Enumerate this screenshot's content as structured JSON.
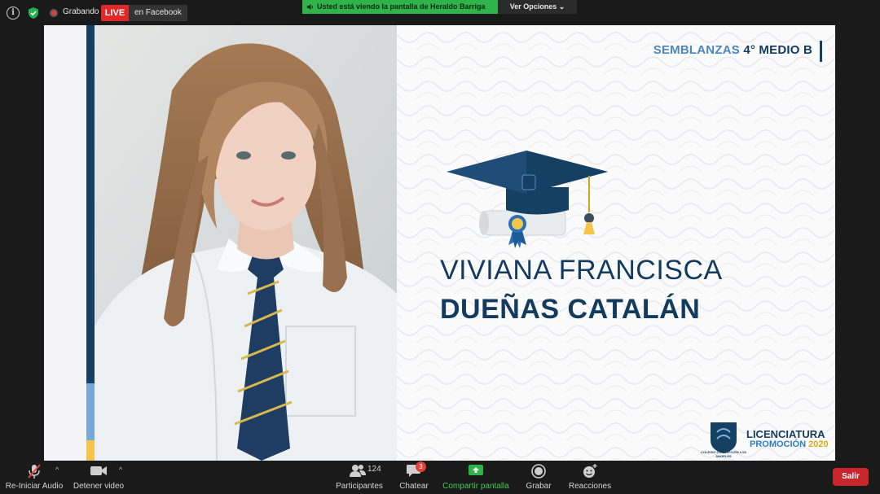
{
  "top_bar": {
    "recording_label": "Grabando",
    "live_badge": "LIVE",
    "live_destination": "en Facebook",
    "share_banner": "Usted está viendo la pantalla de Heraldo Barriga",
    "view_options": "Ver Opciones ⌄"
  },
  "slide": {
    "header_prefix": "SEMBLANZAS",
    "header_class": "4° MEDIO B",
    "name_line1": "VIVIANA FRANCISCA",
    "name_line2": "DUEÑAS CATALÁN",
    "footer_logo_text": "COLEGIO CONCEPCIÓN LOS ÁNGELES",
    "footer_title": "LICENCIATURA",
    "footer_sub_prefix": "PROMOCIÓN",
    "footer_sub_year": "2020",
    "colors": {
      "navy": "#123b5e",
      "light_blue": "#4d86b8",
      "gold": "#f3c64a"
    }
  },
  "toolbar": {
    "audio_label": "Re-Iniciar Audio",
    "video_label": "Detener video",
    "participants_label": "Participantes",
    "participants_count": "124",
    "chat_label": "Chatear",
    "chat_badge": "3",
    "share_label": "Compartir pantalla",
    "record_label": "Grabar",
    "reactions_label": "Reacciones",
    "leave_label": "Salir"
  },
  "icons": [
    "info-icon",
    "shield-icon",
    "record-icon",
    "speaker-icon",
    "mic-muted-icon",
    "camera-icon",
    "participants-icon",
    "chat-icon",
    "share-screen-icon",
    "record-button-icon",
    "reaction-icon"
  ]
}
